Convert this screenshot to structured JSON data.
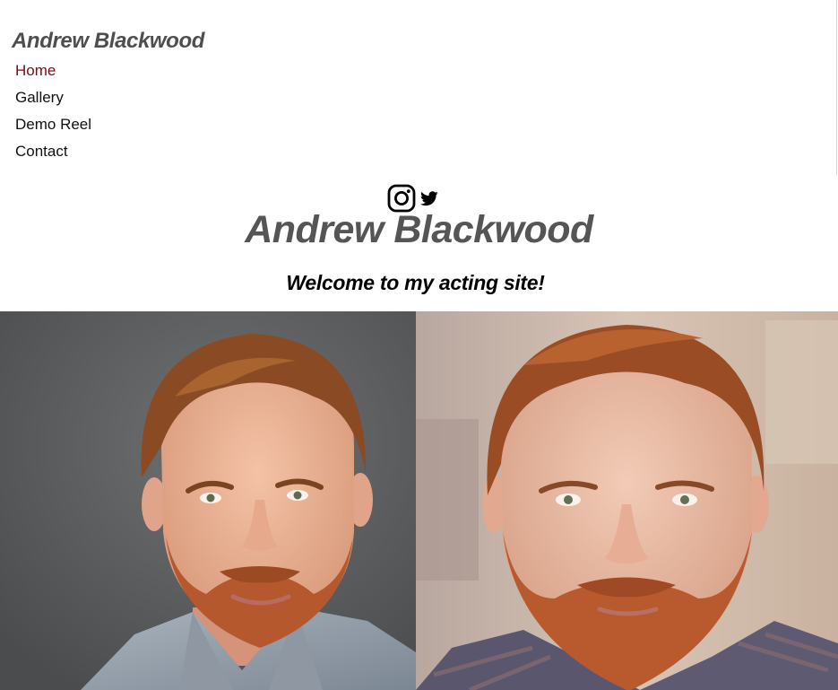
{
  "header": {
    "site_name": "Andrew Blackwood"
  },
  "nav": {
    "items": [
      {
        "label": "Home",
        "active": true
      },
      {
        "label": "Gallery",
        "active": false
      },
      {
        "label": "Demo Reel",
        "active": false
      },
      {
        "label": "Contact",
        "active": false
      }
    ],
    "active_color": "#7a0d0d"
  },
  "social": {
    "icons": [
      "instagram-icon",
      "twitter-icon"
    ]
  },
  "hero": {
    "title": "Andrew Blackwood",
    "subtitle": "Welcome to my acting site!"
  },
  "photos": {
    "items": [
      {
        "name": "headshot-photo-gray-background"
      },
      {
        "name": "headshot-photo-warm-background"
      }
    ]
  },
  "colors": {
    "title_gray": "#555555",
    "text_black": "#000000"
  }
}
